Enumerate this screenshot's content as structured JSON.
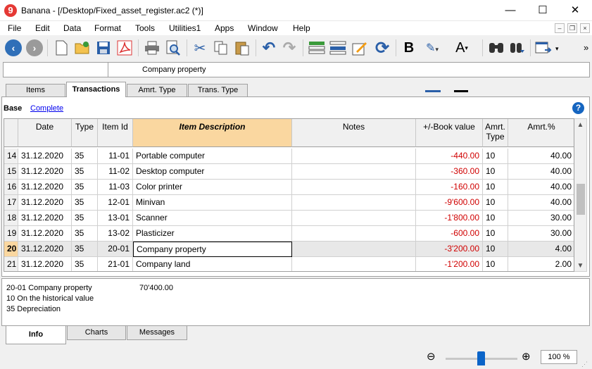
{
  "window": {
    "logo": "9",
    "title": "Banana - [/Desktop/Fixed_asset_register.ac2 (*)]",
    "minimize": "—",
    "maximize": "☐",
    "close": "✕"
  },
  "menu": [
    "File",
    "Edit",
    "Data",
    "Format",
    "Tools",
    "Utilities1",
    "Apps",
    "Window",
    "Help"
  ],
  "toolbar": {
    "icons": [
      "back-icon",
      "forward-icon",
      "new-file-icon",
      "open-file-icon",
      "save-icon",
      "pdf-icon",
      "print-icon",
      "print-preview-icon",
      "cut-icon",
      "copy-icon",
      "paste-icon",
      "undo-icon",
      "redo-icon",
      "add-row-icon",
      "delete-row-icon",
      "edit-icon",
      "recheck-icon",
      "bold-icon",
      "highlight-icon",
      "text-color-icon",
      "find-icon",
      "find-next-icon",
      "window-icon"
    ],
    "bold_label": "B",
    "text_color_label": "A",
    "overflow": "»"
  },
  "cell_editor": {
    "reference": "",
    "content": "Company property"
  },
  "tables": [
    "Items",
    "Transactions",
    "Amrt. Type",
    "Trans. Type"
  ],
  "active_table": "Transactions",
  "views": {
    "base": "Base",
    "complete": "Complete"
  },
  "help_label": "?",
  "grid": {
    "columns": [
      "",
      "Date",
      "Type",
      "Item Id",
      "Item Description",
      "Notes",
      "+/-Book value",
      "Amrt.\nType",
      "Amrt.%"
    ],
    "rows": [
      {
        "num": "14",
        "date": "31.12.2020",
        "type": "35",
        "item_id": "11-01",
        "description": "Portable computer",
        "notes": "",
        "book_value": "-440.00",
        "amrt_type": "10",
        "amrt_pct": "40.00"
      },
      {
        "num": "15",
        "date": "31.12.2020",
        "type": "35",
        "item_id": "11-02",
        "description": "Desktop computer",
        "notes": "",
        "book_value": "-360.00",
        "amrt_type": "10",
        "amrt_pct": "40.00"
      },
      {
        "num": "16",
        "date": "31.12.2020",
        "type": "35",
        "item_id": "11-03",
        "description": "Color printer",
        "notes": "",
        "book_value": "-160.00",
        "amrt_type": "10",
        "amrt_pct": "40.00"
      },
      {
        "num": "17",
        "date": "31.12.2020",
        "type": "35",
        "item_id": "12-01",
        "description": "Minivan",
        "notes": "",
        "book_value": "-9'600.00",
        "amrt_type": "10",
        "amrt_pct": "40.00"
      },
      {
        "num": "18",
        "date": "31.12.2020",
        "type": "35",
        "item_id": "13-01",
        "description": "Scanner",
        "notes": "",
        "book_value": "-1'800.00",
        "amrt_type": "10",
        "amrt_pct": "30.00"
      },
      {
        "num": "19",
        "date": "31.12.2020",
        "type": "35",
        "item_id": "13-02",
        "description": "Plasticizer",
        "notes": "",
        "book_value": "-600.00",
        "amrt_type": "10",
        "amrt_pct": "30.00"
      },
      {
        "num": "20",
        "date": "31.12.2020",
        "type": "35",
        "item_id": "20-01",
        "description": "Company property",
        "notes": "",
        "book_value": "-3'200.00",
        "amrt_type": "10",
        "amrt_pct": "4.00"
      },
      {
        "num": "21",
        "date": "31.12.2020",
        "type": "35",
        "item_id": "21-01",
        "description": "Company land",
        "notes": "",
        "book_value": "-1'200.00",
        "amrt_type": "10",
        "amrt_pct": "2.00"
      }
    ],
    "selected_row": "20"
  },
  "info": {
    "line1": "20-01 Company property",
    "amount": "70'400.00",
    "line2": "10 On the historical value",
    "line3": "35 Depreciation"
  },
  "bottom_tabs": [
    "Info",
    "Charts",
    "Messages"
  ],
  "active_bottom_tab": "Info",
  "zoom": {
    "value": "100 %",
    "level": 100
  },
  "colors": {
    "negative": "#d00000",
    "highlight_header": "#fad7a0",
    "accent": "#0a64c8"
  }
}
